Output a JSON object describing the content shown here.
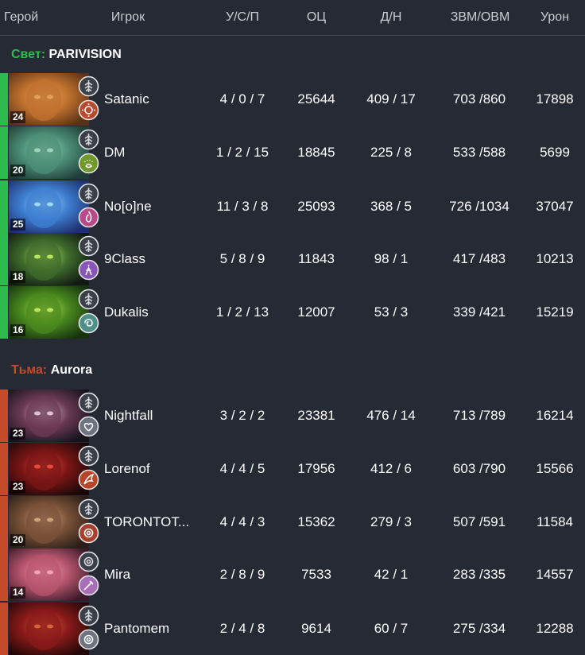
{
  "header": {
    "hero": "Герой",
    "player": "Игрок",
    "kda": "У/С/П",
    "networth": "ОЦ",
    "lh_dn": "Д/Н",
    "gpm_xpm": "ЗВМ/ОВМ",
    "damage": "Урон"
  },
  "radiant": {
    "side": "Свет:",
    "team": "PARIVISION",
    "color": "#2dbb4e",
    "players": [
      {
        "level": "24",
        "player": "Satanic",
        "kda": "4 / 0 / 7",
        "networth": "25644",
        "lh_dn": "409 / 17",
        "gpm_xpm": "703 /860",
        "damage": "17898",
        "hero_icon": "hero-portrait-orange",
        "role_icon": "leaf-icon",
        "class_icon": "sun-icon"
      },
      {
        "level": "20",
        "player": "DM",
        "kda": "1 / 2 / 15",
        "networth": "18845",
        "lh_dn": "225 / 8",
        "gpm_xpm": "533 /588",
        "damage": "5699",
        "hero_icon": "hero-portrait-teal",
        "role_icon": "leaf-icon",
        "class_icon": "paw-icon"
      },
      {
        "level": "25",
        "player": "No[o]ne",
        "kda": "11 / 3 / 8",
        "networth": "25093",
        "lh_dn": "368 / 5",
        "gpm_xpm": "726 /1034",
        "damage": "37047",
        "hero_icon": "hero-portrait-blue",
        "role_icon": "leaf-icon",
        "class_icon": "flame-icon"
      },
      {
        "level": "18",
        "player": "9Class",
        "kda": "5 / 8 / 9",
        "networth": "11843",
        "lh_dn": "98 / 1",
        "gpm_xpm": "417 /483",
        "damage": "10213",
        "hero_icon": "hero-portrait-green-dark",
        "role_icon": "leaf-icon",
        "class_icon": "figure-icon"
      },
      {
        "level": "16",
        "player": "Dukalis",
        "kda": "1 / 2 / 13",
        "networth": "12007",
        "lh_dn": "53 / 3",
        "gpm_xpm": "339 /421",
        "damage": "15219",
        "hero_icon": "hero-portrait-green",
        "role_icon": "leaf-icon",
        "class_icon": "swirl-icon"
      }
    ]
  },
  "dire": {
    "side": "Тьма:",
    "team": "Aurora",
    "color": "#c44a2a",
    "players": [
      {
        "level": "23",
        "player": "Nightfall",
        "kda": "3 / 2 / 2",
        "networth": "23381",
        "lh_dn": "476 / 14",
        "gpm_xpm": "713 /789",
        "damage": "16214",
        "hero_icon": "hero-portrait-dark",
        "role_icon": "leaf-icon",
        "class_icon": "heart-icon"
      },
      {
        "level": "23",
        "player": "Lorenof",
        "kda": "4 / 4 / 5",
        "networth": "17956",
        "lh_dn": "412 / 6",
        "gpm_xpm": "603 /790",
        "damage": "15566",
        "hero_icon": "hero-portrait-red-dark",
        "role_icon": "leaf-icon",
        "class_icon": "wing-icon"
      },
      {
        "level": "20",
        "player": "TORONTOT...",
        "kda": "4 / 4 / 3",
        "networth": "15362",
        "lh_dn": "279 / 3",
        "gpm_xpm": "507 /591",
        "damage": "11584",
        "hero_icon": "hero-portrait-brown",
        "role_icon": "leaf-icon",
        "class_icon": "ring-icon"
      },
      {
        "level": "14",
        "player": "Mira",
        "kda": "2 / 8 / 9",
        "networth": "7533",
        "lh_dn": "42 / 1",
        "gpm_xpm": "283 /335",
        "damage": "14557",
        "hero_icon": "hero-portrait-pink",
        "role_icon": "ring-icon",
        "class_icon": "blade-icon"
      },
      {
        "level": "",
        "player": "Pantomem",
        "kda": "2 / 4 / 8",
        "networth": "9614",
        "lh_dn": "60 / 7",
        "gpm_xpm": "275 /334",
        "damage": "12288",
        "hero_icon": "hero-portrait-crimson",
        "role_icon": "leaf-icon",
        "class_icon": "ring-icon"
      }
    ]
  }
}
